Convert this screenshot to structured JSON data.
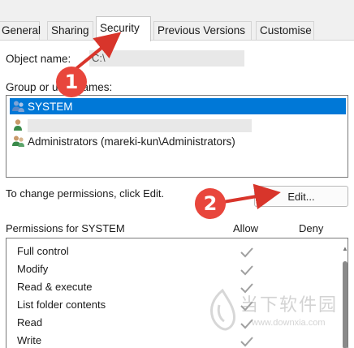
{
  "tabs": [
    {
      "label": "General",
      "active": false
    },
    {
      "label": "Sharing",
      "active": false
    },
    {
      "label": "Security",
      "active": true
    },
    {
      "label": "Previous Versions",
      "active": false
    },
    {
      "label": "Customise",
      "active": false
    }
  ],
  "object_name": {
    "label": "Object name:",
    "value": "C:\\"
  },
  "groups": {
    "label": "Group or user names:",
    "items": [
      {
        "name": "SYSTEM",
        "selected": true,
        "icon": "user-group-icon"
      },
      {
        "name": "",
        "selected": false,
        "icon": "user-icon"
      },
      {
        "name": "Administrators (mareki-kun\\Administrators)",
        "selected": false,
        "icon": "user-group-icon"
      }
    ]
  },
  "change_hint": "To change permissions, click Edit.",
  "edit_button": "Edit...",
  "permissions": {
    "header": "Permissions for SYSTEM",
    "allow_label": "Allow",
    "deny_label": "Deny",
    "rows": [
      {
        "name": "Full control",
        "allow": true,
        "deny": false
      },
      {
        "name": "Modify",
        "allow": true,
        "deny": false
      },
      {
        "name": "Read & execute",
        "allow": true,
        "deny": false
      },
      {
        "name": "List folder contents",
        "allow": true,
        "deny": false
      },
      {
        "name": "Read",
        "allow": true,
        "deny": false
      },
      {
        "name": "Write",
        "allow": true,
        "deny": false
      }
    ]
  },
  "markers": [
    {
      "number": "1"
    },
    {
      "number": "2"
    }
  ],
  "watermark": {
    "title": "当下软件园",
    "url": "www.downxia.com"
  },
  "colors": {
    "selection": "#0078d7",
    "marker": "#e8463c",
    "check": "#a0a0a0"
  }
}
